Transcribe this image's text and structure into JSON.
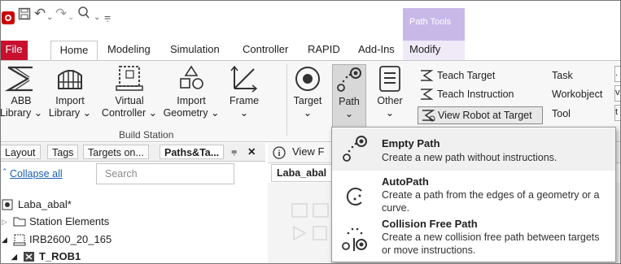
{
  "title_bar": {
    "context_tab_group": "Path Tools"
  },
  "tabs": [
    "File",
    "Home",
    "Modeling",
    "Simulation",
    "Controller",
    "RAPID",
    "Add-Ins",
    "Modify"
  ],
  "ribbon": {
    "abb_library": [
      "ABB",
      "Library"
    ],
    "import_library": [
      "Import",
      "Library"
    ],
    "virtual_controller": [
      "Virtual",
      "Controller"
    ],
    "import_geometry": [
      "Import",
      "Geometry"
    ],
    "frame": "Frame",
    "target": "Target",
    "path": "Path",
    "other": "Other",
    "group_label": "Build Station",
    "teach_target": "Teach Target",
    "teach_instruction": "Teach Instruction",
    "view_robot_at_target": "View Robot at Target",
    "task": "Task",
    "workobject": "Workobject",
    "tool": "Tool",
    "right_cut": [
      ".",
      "v",
      "t"
    ]
  },
  "left_panel": {
    "tabs": [
      "Layout",
      "Tags",
      "Targets on...",
      "Paths&Ta..."
    ],
    "collapse_all": "Collapse all",
    "search_placeholder": "Search",
    "tree": [
      "Laba_abal*",
      "Station Elements",
      "IRB2600_20_165",
      "T_ROB1"
    ]
  },
  "info_bar": {
    "text": "View F"
  },
  "doc_tab": "Laba_abal",
  "dropdown": {
    "items": [
      {
        "title": "Empty Path",
        "desc": "Create a new path without instructions."
      },
      {
        "title": "AutoPath",
        "desc": "Create a path from the edges of a geometry or a curve."
      },
      {
        "title": "Collision Free Path",
        "desc": "Create a new collision free path between targets or move instructions."
      }
    ]
  },
  "colors": {
    "file_tab": "#c8102e",
    "context_purple": "#c8b8e8",
    "link_blue": "#1a5fb4"
  }
}
